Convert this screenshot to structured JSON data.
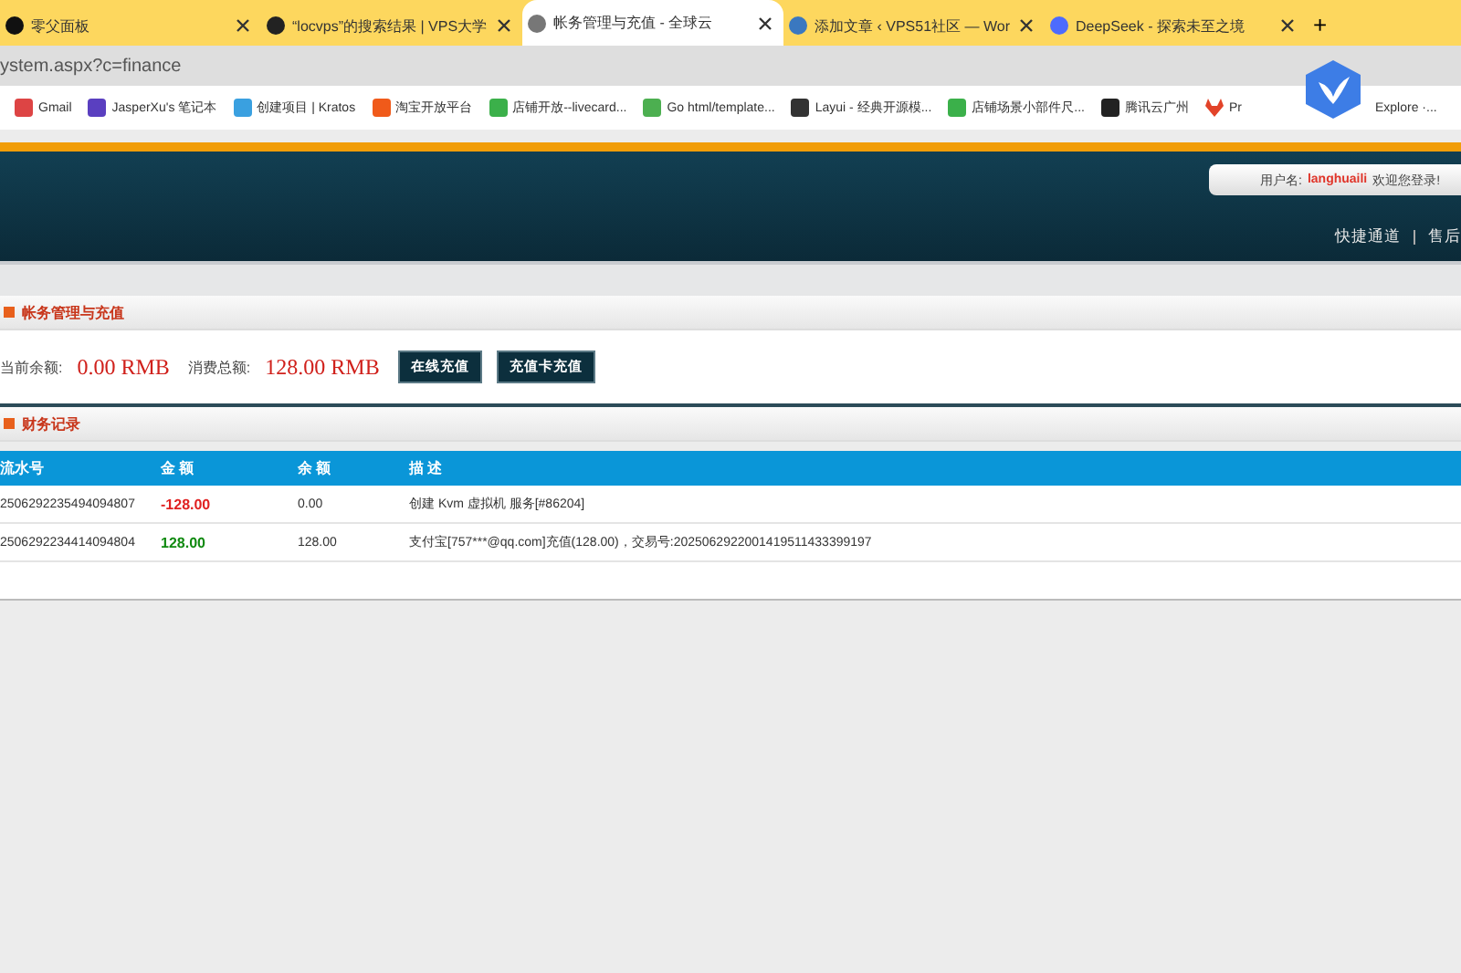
{
  "tabs": [
    {
      "title": "零父面板",
      "selected": false
    },
    {
      "title": "“locvps”的搜索结果 | VPS大学",
      "selected": false
    },
    {
      "title": "帐务管理与充值 - 全球云",
      "selected": true
    },
    {
      "title": "添加文章 ‹ VPS51社区 — Wor",
      "selected": false
    },
    {
      "title": "DeepSeek - 探索未至之境",
      "selected": false
    }
  ],
  "new_tab": "+",
  "address": "ystem.aspx?c=finance",
  "bookmarks": [
    "Gmail",
    "JasperXu's 笔记本",
    "创建项目 | Kratos",
    "淘宝开放平台",
    "店铺开放--livecard...",
    "Go html/template...",
    "Layui - 经典开源模...",
    "店铺场景小部件尺...",
    "腾讯云广州"
  ],
  "partial_bookmark": {
    "start": "Pr",
    "end": "Explore ·..."
  },
  "header": {
    "user_label": "用户名:",
    "username": "langhuaili",
    "welcome": "欢迎您登录!",
    "nav": [
      "快捷通道",
      "售后"
    ]
  },
  "account": {
    "title": "帐务管理与充值",
    "balance_label": "当前余额:",
    "balance": "0.00 RMB",
    "spent_label": "消费总额:",
    "spent": "128.00 RMB",
    "buttons": [
      "在线充值",
      "充值卡充值"
    ]
  },
  "records": {
    "title": "财务记录",
    "columns": [
      "流水号",
      "金 额",
      "余 额",
      "描 述"
    ],
    "rows": [
      {
        "serial": "2506292235494094807",
        "amount": "-128.00",
        "kind": "debit",
        "balance": "0.00",
        "description": "创建 Kvm 虚拟机 服务[#86204]"
      },
      {
        "serial": "2506292234414094804",
        "amount": "128.00",
        "kind": "credit",
        "balance": "128.00",
        "description": "支付宝[757***@qq.com]充值(128.00)，交易号:2025062922001419511433399197"
      }
    ]
  }
}
